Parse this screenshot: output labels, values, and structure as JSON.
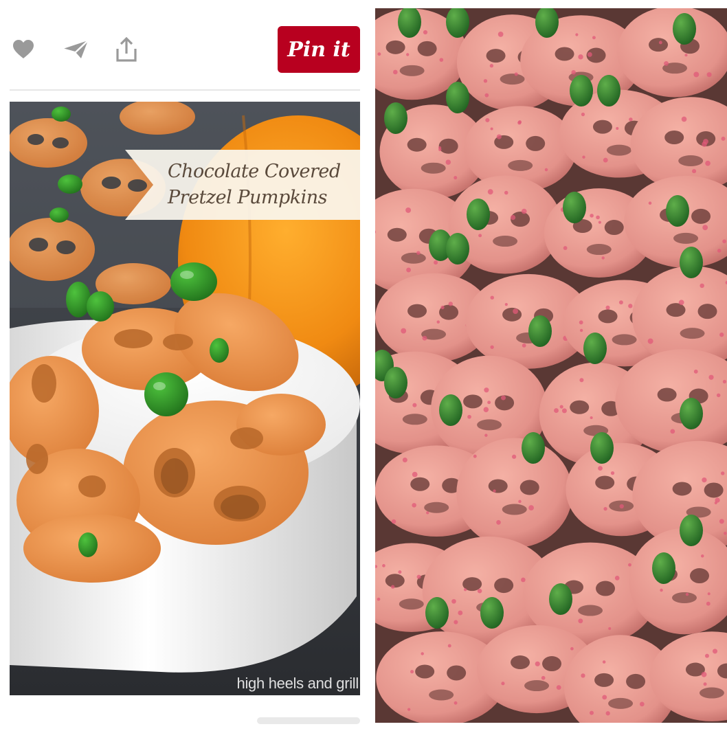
{
  "pin_card": {
    "actions": {
      "like_icon": "heart-icon",
      "send_icon": "paper-plane-icon",
      "share_icon": "share-upload-icon",
      "pin_it_label": "Pin it"
    },
    "image": {
      "title_line_1": "Chocolate Covered",
      "title_line_2": "Pretzel Pumpkins",
      "watermark": "high heels and grill"
    }
  },
  "colors": {
    "pin_it_red": "#b8001f",
    "icon_gray": "#9a9a9a",
    "pretzel_orange": "#e8904a",
    "candy_green": "#2f8a2a",
    "pink_coating": "#e8988e"
  }
}
